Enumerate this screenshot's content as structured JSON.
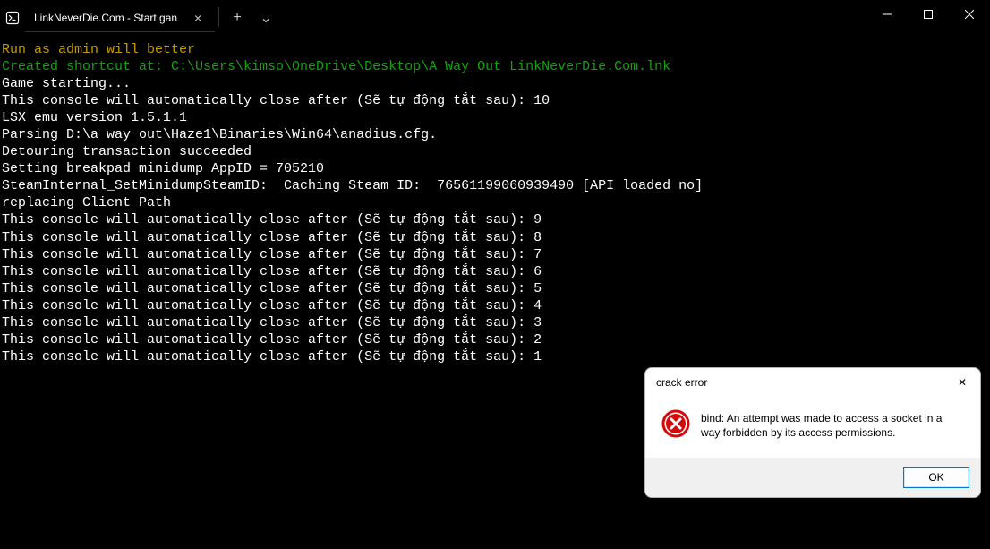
{
  "titlebar": {
    "tab_title": "LinkNeverDie.Com - Start gan",
    "tab_close_glyph": "×",
    "new_tab_glyph": "+",
    "dropdown_glyph": "⌄"
  },
  "terminal": {
    "lines": [
      {
        "cls": "t-yellow",
        "text": "Run as admin will better"
      },
      {
        "cls": "t-green",
        "text": "Created shortcut at: C:\\Users\\kimso\\OneDrive\\Desktop\\A Way Out LinkNeverDie.Com.lnk"
      },
      {
        "cls": "t-white",
        "text": "Game starting..."
      },
      {
        "cls": "t-white",
        "text": "This console will automatically close after (Sẽ tự động tắt sau): 10"
      },
      {
        "cls": "t-white",
        "text": "LSX emu version 1.5.1.1"
      },
      {
        "cls": "t-white",
        "text": "Parsing D:\\a way out\\Haze1\\Binaries\\Win64\\anadius.cfg."
      },
      {
        "cls": "t-white",
        "text": "Detouring transaction succeeded"
      },
      {
        "cls": "t-white",
        "text": "Setting breakpad minidump AppID = 705210"
      },
      {
        "cls": "t-white",
        "text": "SteamInternal_SetMinidumpSteamID:  Caching Steam ID:  76561199060939490 [API loaded no]"
      },
      {
        "cls": "t-white",
        "text": "replacing Client Path"
      },
      {
        "cls": "t-white",
        "text": "This console will automatically close after (Sẽ tự động tắt sau): 9"
      },
      {
        "cls": "t-white",
        "text": "This console will automatically close after (Sẽ tự động tắt sau): 8"
      },
      {
        "cls": "t-white",
        "text": "This console will automatically close after (Sẽ tự động tắt sau): 7"
      },
      {
        "cls": "t-white",
        "text": "This console will automatically close after (Sẽ tự động tắt sau): 6"
      },
      {
        "cls": "t-white",
        "text": "This console will automatically close after (Sẽ tự động tắt sau): 5"
      },
      {
        "cls": "t-white",
        "text": "This console will automatically close after (Sẽ tự động tắt sau): 4"
      },
      {
        "cls": "t-white",
        "text": "This console will automatically close after (Sẽ tự động tắt sau): 3"
      },
      {
        "cls": "t-white",
        "text": "This console will automatically close after (Sẽ tự động tắt sau): 2"
      },
      {
        "cls": "t-white",
        "text": "This console will automatically close after (Sẽ tự động tắt sau): 1"
      }
    ]
  },
  "dialog": {
    "title": "crack error",
    "close_glyph": "✕",
    "message": "bind: An attempt was made to access a socket in a way forbidden by its access permissions.",
    "ok_label": "OK"
  }
}
